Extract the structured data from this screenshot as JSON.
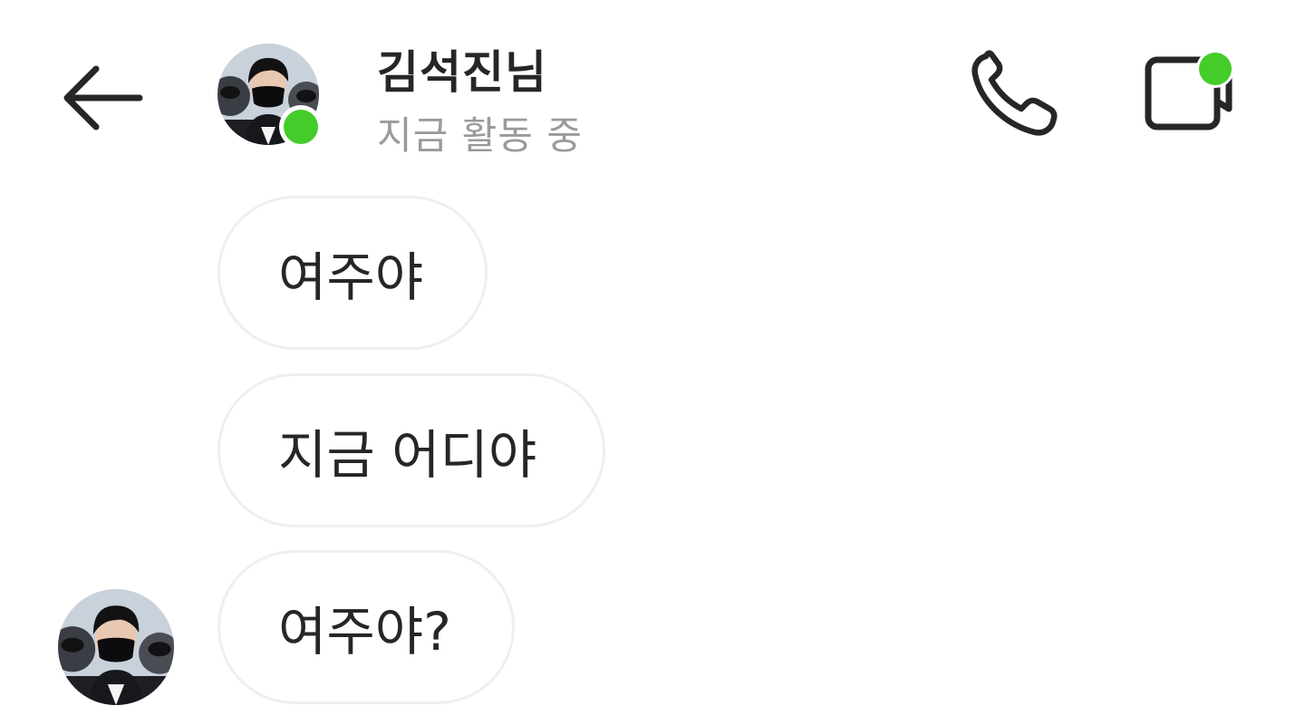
{
  "header": {
    "user_name": "김석진님",
    "status": "지금 활동 중",
    "back_icon": "arrow-left-icon",
    "call_icon": "phone-icon",
    "video_icon": "video-camera-icon",
    "online_color": "#44cc2a"
  },
  "messages": [
    {
      "text": "여주야"
    },
    {
      "text": "지금 어디야"
    },
    {
      "text": "여주야?"
    }
  ],
  "colors": {
    "bubble_border": "#efefef",
    "text": "#262626",
    "muted": "#9a9a9a"
  }
}
